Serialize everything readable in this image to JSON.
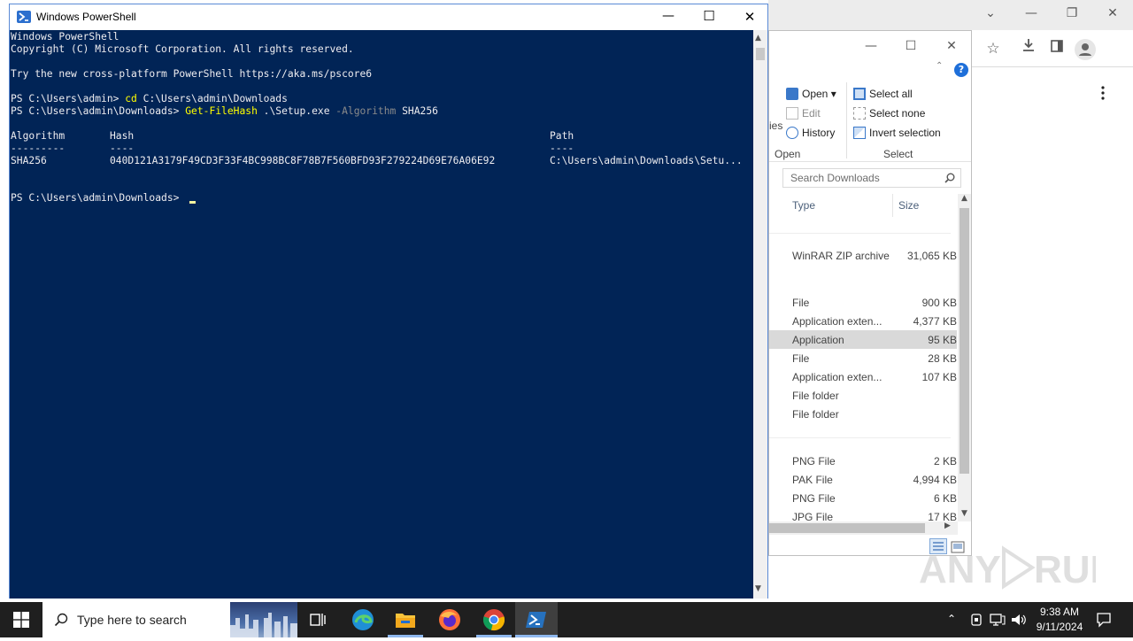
{
  "powershell": {
    "title": "Windows PowerShell",
    "lines": {
      "l1": "Windows PowerShell",
      "l2": "Copyright (C) Microsoft Corporation. All rights reserved.",
      "l3": "Try the new cross-platform PowerShell https://aka.ms/pscore6",
      "prompt1": "PS C:\\Users\\admin> ",
      "cmd1_verb": "cd",
      "cmd1_arg": " C:\\Users\\admin\\Downloads",
      "prompt2": "PS C:\\Users\\admin\\Downloads> ",
      "cmd2_verb": "Get-FileHash",
      "cmd2_arg": " .\\Setup.exe ",
      "cmd2_param": "-Algorithm",
      "cmd2_val": " SHA256",
      "col_algorithm": "Algorithm",
      "col_hash": "Hash",
      "col_path": "Path",
      "sep_algorithm": "---------",
      "sep_hash": "----",
      "sep_path": "----",
      "val_algorithm": "SHA256",
      "val_hash": "040D121A3179F49CD3F33F4BC998BC8F78B7F560BFD93F279224D69E76A06E92",
      "val_path": "C:\\Users\\admin\\Downloads\\Setu...",
      "prompt3": "PS C:\\Users\\admin\\Downloads> "
    }
  },
  "explorer": {
    "ribbon": {
      "open": "Open",
      "edit": "Edit",
      "history": "History",
      "group_open": "Open",
      "select_all": "Select all",
      "select_none": "Select none",
      "invert_selection": "Invert selection",
      "group_select": "Select",
      "cut_label": "ies"
    },
    "search_placeholder": "Search Downloads",
    "columns": {
      "type": "Type",
      "size": "Size"
    },
    "rows": [
      {
        "type": "WinRAR ZIP archive",
        "size": "31,065 KB"
      },
      {
        "type": "File",
        "size": "900 KB"
      },
      {
        "type": "Application exten...",
        "size": "4,377 KB"
      },
      {
        "type": "Application",
        "size": "95 KB"
      },
      {
        "type": "File",
        "size": "28 KB"
      },
      {
        "type": "Application exten...",
        "size": "107 KB"
      },
      {
        "type": "File folder",
        "size": ""
      },
      {
        "type": "File folder",
        "size": ""
      },
      {
        "type": "PNG File",
        "size": "2 KB"
      },
      {
        "type": "PAK File",
        "size": "4,994 KB"
      },
      {
        "type": "PNG File",
        "size": "6 KB"
      },
      {
        "type": "JPG File",
        "size": "17 KB"
      }
    ]
  },
  "taskbar": {
    "search_placeholder": "Type here to search",
    "time": "9:38 AM",
    "date": "9/11/2024"
  },
  "watermark": "ANY RUN"
}
